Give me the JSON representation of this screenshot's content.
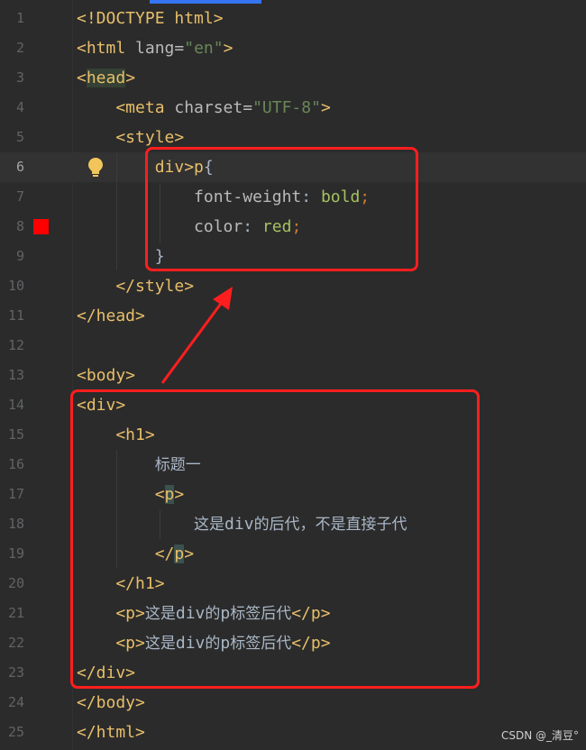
{
  "editor": {
    "lines": [
      {
        "n": "1",
        "parts": [
          {
            "t": "<!DOCTYPE html>",
            "c": "tag"
          }
        ]
      },
      {
        "n": "2",
        "parts": [
          {
            "t": "<html ",
            "c": "tag"
          },
          {
            "t": "lang",
            "c": "attr"
          },
          {
            "t": "=",
            "c": "attr"
          },
          {
            "t": "\"en\"",
            "c": "val"
          },
          {
            "t": ">",
            "c": "tag"
          }
        ]
      },
      {
        "n": "3",
        "parts": [
          {
            "t": "<",
            "c": "tag"
          },
          {
            "t": "head",
            "c": "tag hl2"
          },
          {
            "t": ">",
            "c": "tag"
          }
        ]
      },
      {
        "n": "4",
        "parts": [
          {
            "t": "    <meta ",
            "c": "tag"
          },
          {
            "t": "charset",
            "c": "attr"
          },
          {
            "t": "=",
            "c": "attr"
          },
          {
            "t": "\"UTF-8\"",
            "c": "val"
          },
          {
            "t": ">",
            "c": "tag"
          }
        ]
      },
      {
        "n": "5",
        "parts": [
          {
            "t": "    <style>",
            "c": "tag"
          }
        ]
      },
      {
        "n": "6",
        "parts": [
          {
            "t": "        div>p",
            "c": "sel"
          },
          {
            "t": "{",
            "c": "brace"
          }
        ]
      },
      {
        "n": "7",
        "parts": [
          {
            "t": "            font-weight",
            "c": "prop"
          },
          {
            "t": ": ",
            "c": "brace"
          },
          {
            "t": "bold",
            "c": "cssv"
          },
          {
            "t": ";",
            "c": "punct"
          }
        ]
      },
      {
        "n": "8",
        "parts": [
          {
            "t": "            color",
            "c": "prop"
          },
          {
            "t": ": ",
            "c": "brace"
          },
          {
            "t": "red",
            "c": "cssv"
          },
          {
            "t": ";",
            "c": "punct"
          }
        ]
      },
      {
        "n": "9",
        "parts": [
          {
            "t": "        }",
            "c": "brace"
          }
        ]
      },
      {
        "n": "10",
        "parts": [
          {
            "t": "    </style>",
            "c": "tag"
          }
        ]
      },
      {
        "n": "11",
        "parts": [
          {
            "t": "</head>",
            "c": "tag"
          }
        ]
      },
      {
        "n": "12",
        "parts": []
      },
      {
        "n": "13",
        "parts": [
          {
            "t": "<body>",
            "c": "tag"
          }
        ]
      },
      {
        "n": "14",
        "parts": [
          {
            "t": "<div>",
            "c": "tag"
          }
        ]
      },
      {
        "n": "15",
        "parts": [
          {
            "t": "    <h1>",
            "c": "tag"
          }
        ]
      },
      {
        "n": "16",
        "parts": [
          {
            "t": "        ",
            "c": "brace"
          },
          {
            "t": "标题一",
            "c": "cjk"
          }
        ]
      },
      {
        "n": "17",
        "parts": [
          {
            "t": "        <",
            "c": "tag"
          },
          {
            "t": "p",
            "c": "tag hl"
          },
          {
            "t": ">",
            "c": "tag"
          }
        ]
      },
      {
        "n": "18",
        "parts": [
          {
            "t": "            ",
            "c": "brace"
          },
          {
            "t": "这是",
            "c": "cjk"
          },
          {
            "t": "div",
            "c": "brace"
          },
          {
            "t": "的后代，不是直接子代",
            "c": "cjk"
          }
        ]
      },
      {
        "n": "19",
        "parts": [
          {
            "t": "        </",
            "c": "tag"
          },
          {
            "t": "p",
            "c": "tag hl"
          },
          {
            "t": ">",
            "c": "tag"
          }
        ]
      },
      {
        "n": "20",
        "parts": [
          {
            "t": "    </h1>",
            "c": "tag"
          }
        ]
      },
      {
        "n": "21",
        "parts": [
          {
            "t": "    <p>",
            "c": "tag"
          },
          {
            "t": "这是",
            "c": "cjk"
          },
          {
            "t": "div",
            "c": "brace"
          },
          {
            "t": "的",
            "c": "cjk"
          },
          {
            "t": "p",
            "c": "brace"
          },
          {
            "t": "标签后代",
            "c": "cjk"
          },
          {
            "t": "</p>",
            "c": "tag"
          }
        ]
      },
      {
        "n": "22",
        "parts": [
          {
            "t": "    <p>",
            "c": "tag"
          },
          {
            "t": "这是",
            "c": "cjk"
          },
          {
            "t": "div",
            "c": "brace"
          },
          {
            "t": "的",
            "c": "cjk"
          },
          {
            "t": "p",
            "c": "brace"
          },
          {
            "t": "标签后代",
            "c": "cjk"
          },
          {
            "t": "</p>",
            "c": "tag"
          }
        ]
      },
      {
        "n": "23",
        "parts": [
          {
            "t": "</div>",
            "c": "tag"
          }
        ]
      },
      {
        "n": "24",
        "parts": [
          {
            "t": "</body>",
            "c": "tag"
          }
        ]
      },
      {
        "n": "25",
        "parts": [
          {
            "t": "</html>",
            "c": "tag"
          }
        ]
      }
    ],
    "current_line": "6",
    "breakpoint_line": "8",
    "bulb_line": "6",
    "bulb_icon": "lightbulb-icon",
    "annotation_color": "#ff1e1e"
  },
  "watermark": "CSDN @_清豆°"
}
